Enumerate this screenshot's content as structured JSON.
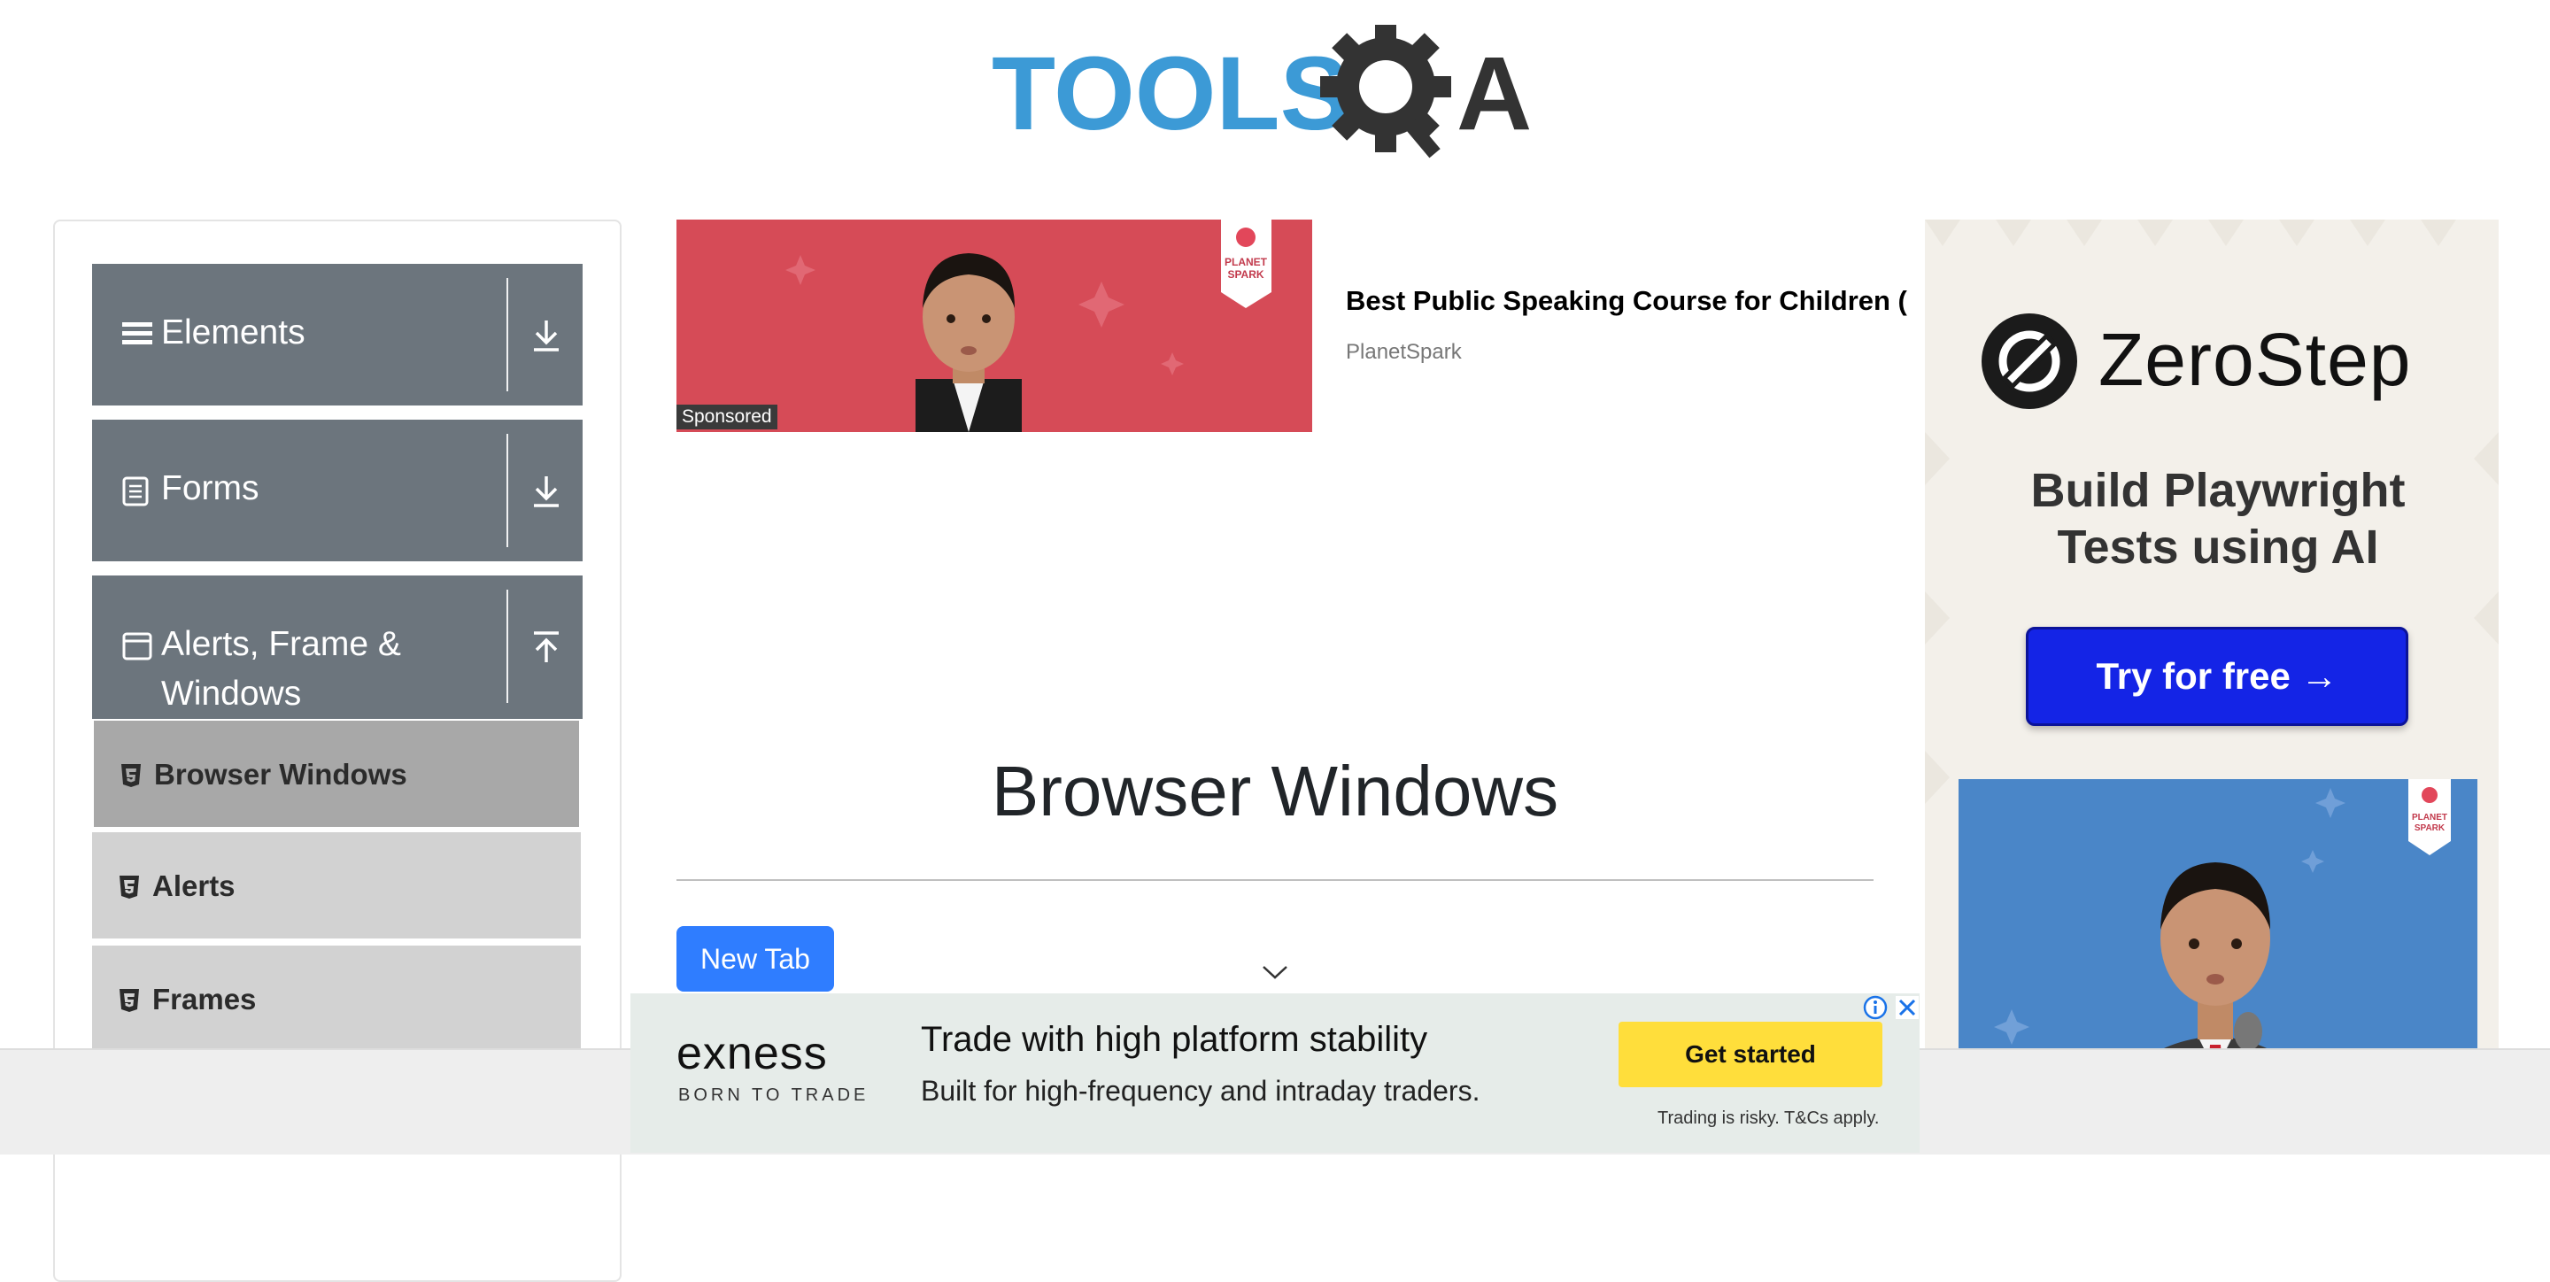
{
  "brand": {
    "logo_text": "TOOLSQA",
    "logo_color": "#3c9ad6"
  },
  "sidebar": {
    "groups": [
      {
        "title": "Elements",
        "icon": "hamburger-icon",
        "state": "collapsed"
      },
      {
        "title": "Forms",
        "icon": "document-icon",
        "state": "collapsed"
      },
      {
        "title_line1": "Alerts, Frame &",
        "title_line2": "Windows",
        "icon": "window-icon",
        "state": "expanded"
      }
    ],
    "items": [
      {
        "label": "Browser Windows",
        "icon": "html5-icon",
        "active": true
      },
      {
        "label": "Alerts",
        "icon": "html5-icon",
        "active": false
      },
      {
        "label": "Frames",
        "icon": "html5-icon",
        "active": false
      }
    ]
  },
  "top_ad": {
    "sponsored": "Sponsored",
    "title": "Best Public Speaking Course for Children (",
    "source": "PlanetSpark",
    "badge": "PLANET SPARK"
  },
  "main": {
    "title": "Browser Windows",
    "new_tab_button": "New Tab"
  },
  "right_ad": {
    "brand": "ZeroStep",
    "headline_line1": "Build Playwright",
    "headline_line2": "Tests using AI",
    "cta": "Try for free →",
    "badge": "PLANET SPARK"
  },
  "bottom_ad": {
    "brand": "exness",
    "tagline": "BORN TO TRADE",
    "headline": "Trade with high platform stability",
    "subline": "Built for high-frequency and intraday traders.",
    "cta": "Get started",
    "risk": "Trading is risky. T&Cs apply."
  },
  "colors": {
    "sidebar_header": "#6c757d",
    "menu_item": "#d2d2d2",
    "menu_item_active": "#a8a8a8",
    "primary_button": "#2f7dff",
    "zerostep_cta": "#1424e6",
    "exness_cta": "#ffde3b"
  }
}
